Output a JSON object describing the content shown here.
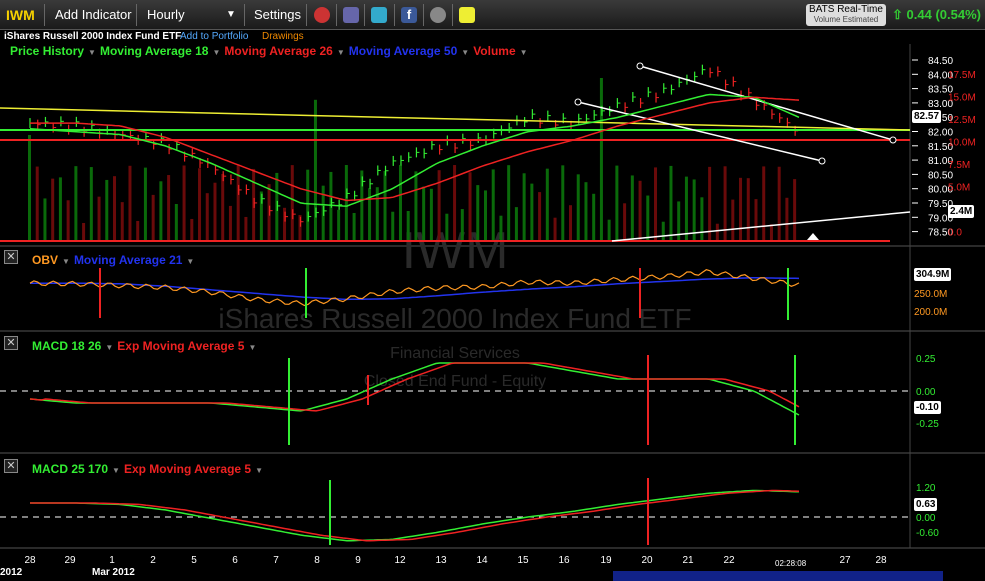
{
  "toolbar": {
    "symbol": "IWM",
    "add_indicator": "Add Indicator",
    "interval": "Hourly",
    "settings": "Settings",
    "realtime_title": "BATS Real-Time",
    "realtime_sub": "Volume Estimated",
    "change": "0.44 (0.54%)",
    "change_arrow": "up-arrow-icon"
  },
  "subbar": {
    "name": "iShares Russell 2000 Index Fund ETF",
    "add_portfolio": "Add to Portfolio",
    "drawings": "Drawings"
  },
  "watermark": {
    "symbol": "IWM",
    "name": "iShares Russell 2000 Index Fund ETF",
    "sector": "Financial Services",
    "industry": "Closed End Fund - Equity"
  },
  "price_panel": {
    "legend": [
      {
        "label": "Price History",
        "color": "#33ee33"
      },
      {
        "label": "Moving Average 18",
        "color": "#33ee33"
      },
      {
        "label": "Moving Average 26",
        "color": "#ee2222"
      },
      {
        "label": "Moving Average 50",
        "color": "#2233ee"
      },
      {
        "label": "Volume",
        "color": "#ee2222"
      }
    ],
    "price_ticks": [
      "84.50",
      "84.00",
      "83.50",
      "83.00",
      "82.50",
      "82.00",
      "81.50",
      "81.00",
      "80.50",
      "80.00",
      "79.50",
      "79.00",
      "78.50"
    ],
    "volume_ticks": [
      "17.5M",
      "15.0M",
      "12.5M",
      "10.0M",
      "7.5M",
      "5.0M",
      "2.5M",
      "0.0"
    ],
    "last_price": "82.57",
    "last_volume": "2.4M"
  },
  "obv_panel": {
    "legend": [
      {
        "label": "OBV",
        "color": "#ff9922"
      },
      {
        "label": "Moving Average 21",
        "color": "#2233ee"
      }
    ],
    "ticks": [
      "250.0M",
      "200.0M"
    ],
    "last": "304.9M"
  },
  "macd1_panel": {
    "legend": [
      {
        "label": "MACD 18 26",
        "color": "#33ee33"
      },
      {
        "label": "Exp Moving Average 5",
        "color": "#ee2222"
      }
    ],
    "ticks": [
      "0.25",
      "0.00",
      "-0.25"
    ],
    "last": "-0.10"
  },
  "macd2_panel": {
    "legend": [
      {
        "label": "MACD 25 170",
        "color": "#33ee33"
      },
      {
        "label": "Exp Moving Average 5",
        "color": "#ee2222"
      }
    ],
    "ticks": [
      "1.20",
      "0.00",
      "-0.60"
    ],
    "last": "0.63"
  },
  "x_axis": {
    "labels": [
      "28",
      "29",
      "1",
      "2",
      "5",
      "6",
      "7",
      "8",
      "9",
      "12",
      "13",
      "14",
      "15",
      "16",
      "19",
      "20",
      "21",
      "22",
      "27",
      "28"
    ],
    "month_labels": [
      "2012",
      "Mar 2012"
    ],
    "cursor_time": "02:28:08"
  },
  "chart_data": {
    "type": "line",
    "title": "IWM",
    "x": [
      "28",
      "29",
      "1",
      "2",
      "5",
      "6",
      "7",
      "8",
      "9",
      "12",
      "13",
      "14",
      "15",
      "16",
      "19",
      "20",
      "21",
      "22"
    ],
    "series": [
      {
        "name": "Price History",
        "values": [
          82.3,
          82.2,
          81.9,
          81.6,
          80.8,
          79.6,
          78.9,
          79.7,
          80.9,
          81.5,
          81.7,
          82.5,
          82.3,
          82.9,
          83.4,
          84.2,
          83.1,
          82.0
        ]
      },
      {
        "name": "Moving Average 18",
        "values": [
          82.1,
          82.0,
          81.9,
          81.5,
          80.9,
          80.2,
          79.5,
          79.4,
          80.0,
          80.9,
          81.5,
          82.0,
          82.2,
          82.5,
          82.9,
          83.3,
          83.2,
          82.5
        ]
      },
      {
        "name": "Moving Average 26",
        "values": [
          82.3,
          82.3,
          82.2,
          81.8,
          81.2,
          80.6,
          80.0,
          79.6,
          79.7,
          80.2,
          80.8,
          81.3,
          81.7,
          82.2,
          82.6,
          83.0,
          83.2,
          83.1
        ]
      }
    ],
    "ylim": [
      78.5,
      84.5
    ]
  }
}
